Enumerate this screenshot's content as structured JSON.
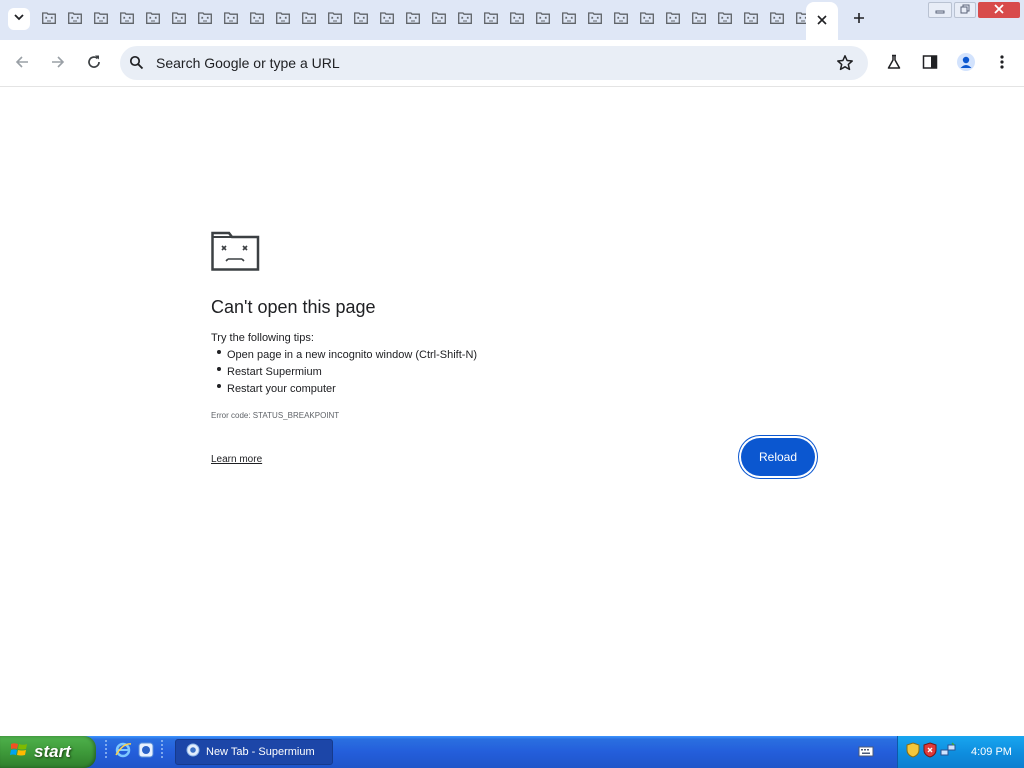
{
  "browser": {
    "tab_count_inactive": 30,
    "tab_icon": "sad-tab-icon",
    "active_tab_icon": "close-icon",
    "omnibox": {
      "placeholder": "Search Google or type a URL"
    }
  },
  "error_page": {
    "title": "Can't open this page",
    "tips_intro": "Try the following tips:",
    "tips": [
      "Open page in a new incognito window (Ctrl-Shift-N)",
      "Restart Supermium",
      "Restart your computer"
    ],
    "error_code": "Error code: STATUS_BREAKPOINT",
    "learn_more": "Learn more",
    "reload_label": "Reload"
  },
  "taskbar": {
    "start_label": "start",
    "window_item": "New Tab - Supermium",
    "clock": "4:09 PM"
  },
  "colors": {
    "accent": "#0b57d0",
    "tabstrip": "#dfe7f6",
    "omnibox": "#e9eef6",
    "taskbar": "#245edb",
    "start": "#3e9a3a"
  }
}
